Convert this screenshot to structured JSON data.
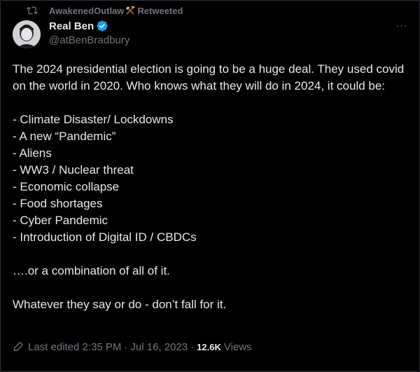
{
  "retweet": {
    "user": "AwakenedOutlaw",
    "label": "Retweeted"
  },
  "author": {
    "name": "Real Ben",
    "handle": "@atBenBradbury"
  },
  "tweet": {
    "intro": "The 2024 presidential election is going to be a huge deal. They used covid on the world in 2020. Who knows what they will do in 2024, it could be:",
    "items": [
      "- Climate Disaster/ Lockdowns",
      "- A new “Pandemic”",
      "- Aliens",
      "- WW3 / Nuclear threat",
      "- Economic collapse",
      "- Food shortages",
      "- Cyber Pandemic",
      "- Introduction of Digital ID / CBDCs"
    ],
    "combo": "….or a combination of all of it.",
    "closing": "Whatever they say or do - don’t fall for it."
  },
  "meta": {
    "edited": "Last edited 2:35 PM",
    "date": "Jul 16, 2023",
    "views_count": "12.6K",
    "views_label": "Views",
    "separator": "·"
  },
  "more_label": "···",
  "icons": {
    "retweet": "retweet-icon",
    "emoji": "hammer-pick-emoji-icon",
    "verified": "verified-badge-icon",
    "edit": "pencil-icon",
    "more": "more-options-icon"
  },
  "colors": {
    "background": "#000000",
    "text": "#e7e9ea",
    "muted": "#71767b",
    "verified": "#1d9bf0"
  }
}
